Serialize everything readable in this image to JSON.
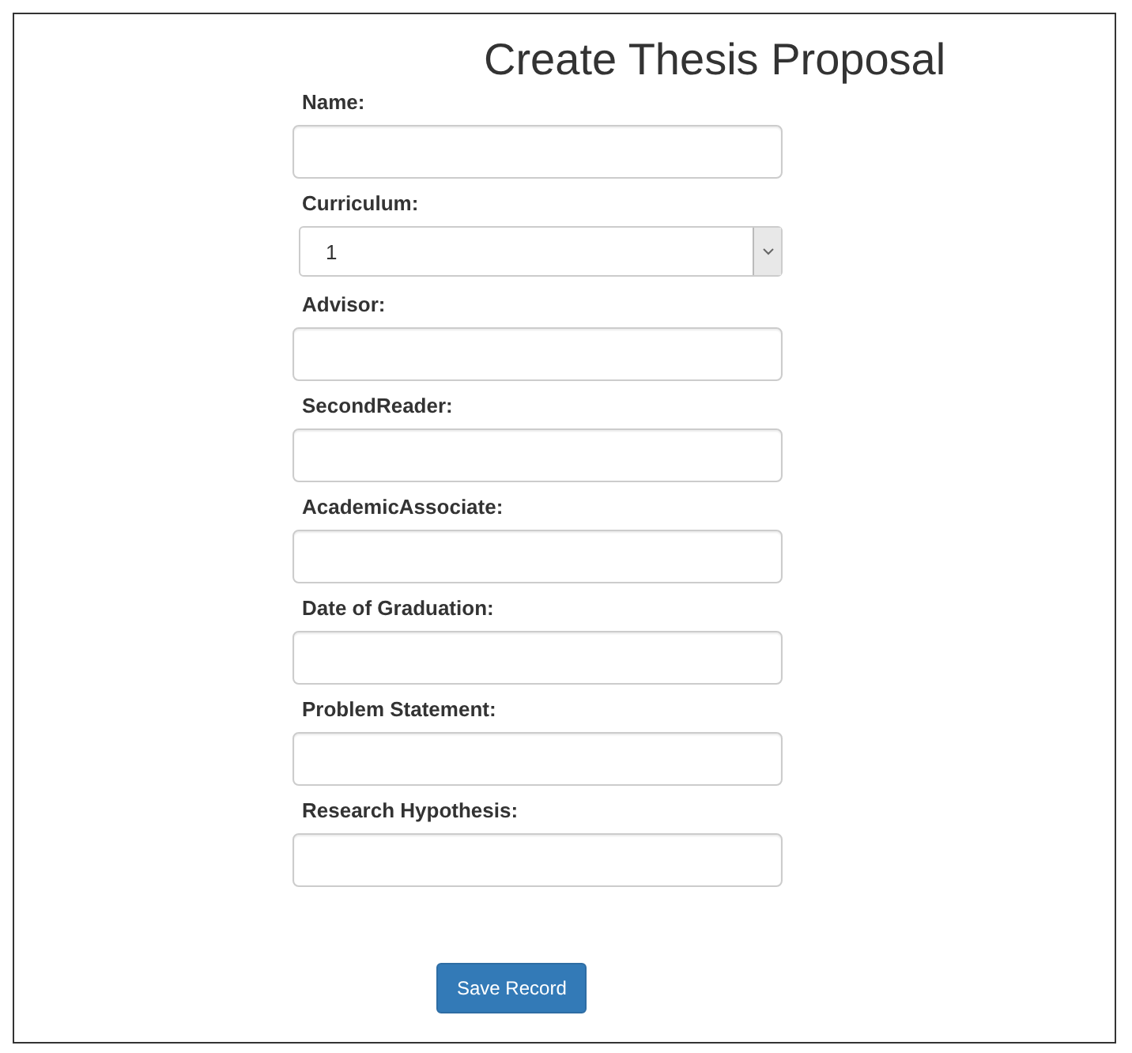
{
  "title": "Create Thesis Proposal",
  "fields": [
    {
      "label": "Name:",
      "kind": "text"
    },
    {
      "label": "Curriculum:",
      "kind": "select",
      "value": "1"
    },
    {
      "label": "Advisor:",
      "kind": "text"
    },
    {
      "label": "SecondReader:",
      "kind": "text"
    },
    {
      "label": "AcademicAssociate:",
      "kind": "text"
    },
    {
      "label": "Date of Graduation:",
      "kind": "text"
    },
    {
      "label": "Problem Statement:",
      "kind": "text"
    },
    {
      "label": "Research Hypothesis:",
      "kind": "text"
    }
  ],
  "button": "Save Record"
}
